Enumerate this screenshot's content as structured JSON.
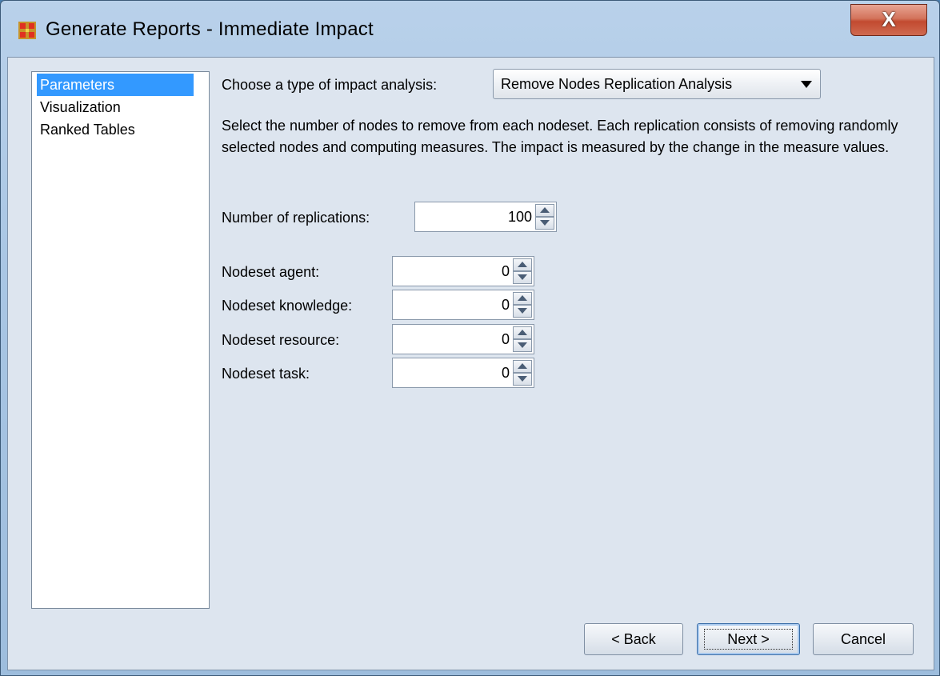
{
  "window": {
    "title": "Generate Reports - Immediate Impact",
    "close_label": "X"
  },
  "nav": {
    "items": [
      {
        "label": "Parameters",
        "selected": true
      },
      {
        "label": "Visualization",
        "selected": false
      },
      {
        "label": "Ranked Tables",
        "selected": false
      }
    ]
  },
  "impact": {
    "label": "Choose a type of impact analysis:",
    "selected_option": "Remove Nodes Replication Analysis"
  },
  "description": "Select the number of nodes to remove from each nodeset. Each replication consists of removing randomly selected nodes and computing measures. The impact is measured by the change in the measure values.",
  "replications": {
    "label": "Number of replications:",
    "value": "100"
  },
  "nodesets": [
    {
      "label": "Nodeset agent:",
      "value": "0"
    },
    {
      "label": "Nodeset knowledge:",
      "value": "0"
    },
    {
      "label": "Nodeset resource:",
      "value": "0"
    },
    {
      "label": "Nodeset task:",
      "value": "0"
    }
  ],
  "buttons": {
    "back": "< Back",
    "next": "Next >",
    "cancel": "Cancel"
  },
  "colors": {
    "selection": "#3399ff",
    "panel": "#dde5ef",
    "close": "#c24a30"
  }
}
